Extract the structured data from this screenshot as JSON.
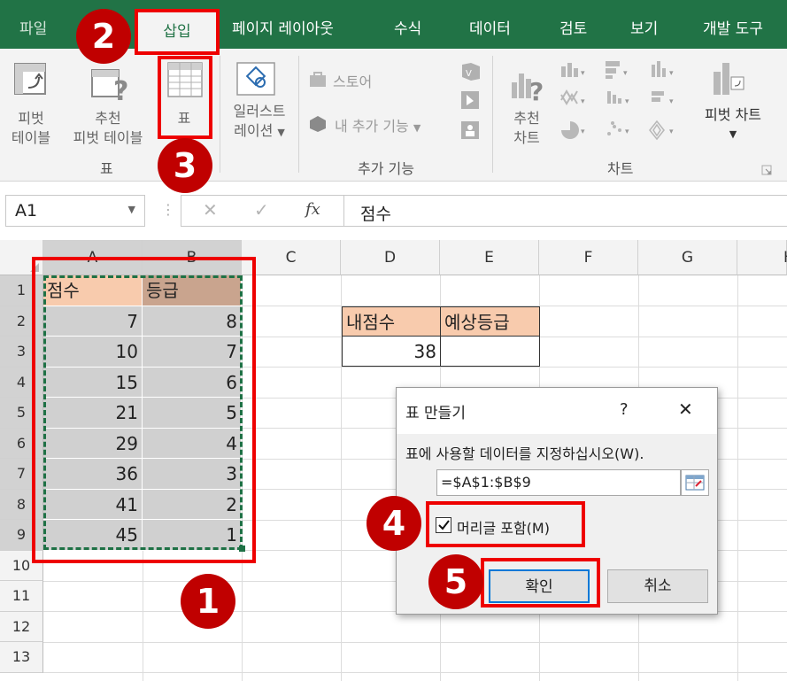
{
  "ribbon_tabs": {
    "file": "파일",
    "insert": "삽입",
    "page_layout": "페이지 레이아웃",
    "formulas": "수식",
    "data": "데이터",
    "review": "검토",
    "view": "보기",
    "developer": "개발 도구"
  },
  "ribbon": {
    "pivot_table_l1": "피벗",
    "pivot_table_l2": "테이블",
    "recommended_pivot_l1": "추천",
    "recommended_pivot_l2": "피벗 테이블",
    "table": "표",
    "illustrations_l1": "일러스트",
    "illustrations_l2": "레이션",
    "store": "스토어",
    "my_addins": "내 추가 기능",
    "recommended_charts_l1": "추천",
    "recommended_charts_l2": "차트",
    "pivot_chart": "피벗 차트",
    "group_tables": "표",
    "group_addins": "추가 기능",
    "group_charts": "차트"
  },
  "formula_bar": {
    "name_box": "A1",
    "cancel": "✕",
    "enter": "✓",
    "fx": "fx",
    "content": "점수"
  },
  "sheet": {
    "columns": [
      "A",
      "B",
      "C",
      "D",
      "E",
      "F",
      "G",
      "H"
    ],
    "rows": [
      "1",
      "2",
      "3",
      "4",
      "5",
      "6",
      "7",
      "8",
      "9",
      "10",
      "11",
      "12",
      "13"
    ],
    "header_a": "점수",
    "header_b": "등급",
    "scores": [
      "7",
      "10",
      "15",
      "21",
      "29",
      "36",
      "41",
      "45"
    ],
    "grades": [
      "8",
      "7",
      "6",
      "5",
      "4",
      "3",
      "2",
      "1"
    ],
    "my_score_label": "내점수",
    "expected_grade_label": "예상등급",
    "my_score_value": "38"
  },
  "dialog": {
    "title": "표 만들기",
    "help": "?",
    "close": "✕",
    "prompt": "표에 사용할 데이터를 지정하십시오(W).",
    "range": "=$A$1:$B$9",
    "header_checkbox": "머리글 포함(M)",
    "header_checked": true,
    "ok": "확인",
    "cancel": "취소"
  },
  "callouts": {
    "step1": "1",
    "step2": "2",
    "step3": "3",
    "step4": "4",
    "step5": "5"
  },
  "colors": {
    "excel_green": "#217346",
    "header_peach": "#f8cbad",
    "header_tan": "#c9a48e",
    "selection_gray": "#d0d0d0",
    "callout_red": "#c00000",
    "highlight_red": "#e00000"
  }
}
